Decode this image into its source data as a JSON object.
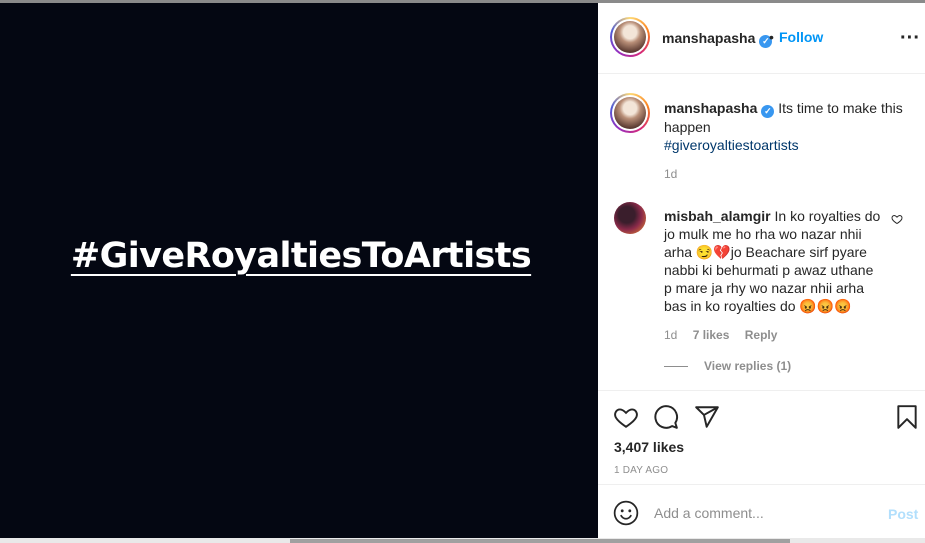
{
  "media": {
    "text": "#GiveRoyaltiesToArtists"
  },
  "header": {
    "username": "manshapasha",
    "separator": "•",
    "follow_label": "Follow",
    "more_icon": "more-horizontal-icon"
  },
  "caption": {
    "username": "manshapasha",
    "text": "Its time to make this happen",
    "hashtag": "#giveroyaltiestoartists",
    "time": "1d"
  },
  "comment": {
    "username": "misbah_alamgir",
    "text": "In ko royalties do jo mulk me ho rha wo nazar nhii arha 😏💔jo Beachare sirf pyare nabbi ki behurmati p awaz uthane p mare ja rhy wo nazar nhii arha bas in ko royalties do 😡😡😡",
    "time": "1d",
    "likes": "7 likes",
    "reply_label": "Reply",
    "view_replies": "View replies (1)"
  },
  "actions": {
    "likes": "3,407 likes",
    "date": "1 DAY AGO"
  },
  "comment_box": {
    "placeholder": "Add a comment...",
    "post_label": "Post"
  },
  "colors": {
    "link": "#0095f6",
    "verified": "#3897f0",
    "post_disabled": "#b2dffc",
    "media_bg": "#040712"
  }
}
